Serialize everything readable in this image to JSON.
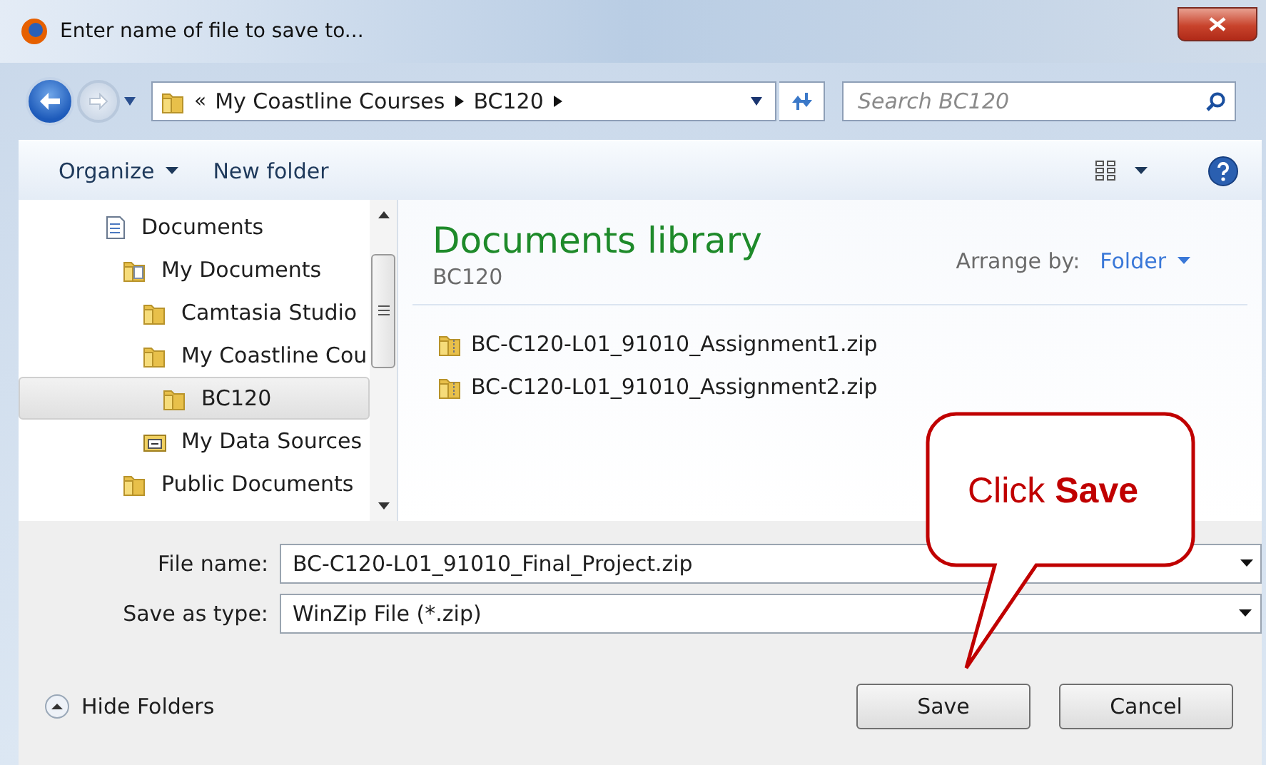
{
  "window": {
    "title": "Enter name of file to save to..."
  },
  "address": {
    "overflow": "«",
    "crumbs": [
      "My Coastline Courses",
      "BC120"
    ]
  },
  "search": {
    "placeholder": "Search BC120"
  },
  "toolbar": [
    "Organize",
    "New folder"
  ],
  "tree": [
    {
      "label": "Documents",
      "kind": "document",
      "selected": false,
      "children": [
        {
          "label": "My Documents",
          "kind": "library",
          "selected": false,
          "children": [
            {
              "label": "Camtasia Studio",
              "kind": "folder",
              "selected": false
            },
            {
              "label": "My Coastline Cou",
              "kind": "folder",
              "selected": false,
              "children": [
                {
                  "label": "BC120",
                  "kind": "folder",
                  "selected": true
                }
              ]
            },
            {
              "label": "My Data Sources",
              "kind": "datasource",
              "selected": false
            }
          ]
        },
        {
          "label": "Public Documents",
          "kind": "folder",
          "selected": false
        }
      ]
    }
  ],
  "library": {
    "title": "Documents library",
    "subtitle": "BC120",
    "arrange_label": "Arrange by:",
    "arrange_value": "Folder"
  },
  "files": [
    "BC-C120-L01_91010_Assignment1.zip",
    "BC-C120-L01_91010_Assignment2.zip"
  ],
  "form": {
    "file_name_label": "File name:",
    "file_name": "BC-C120-L01_91010_Final_Project.zip",
    "type_label": "Save as type:",
    "type": "WinZip File (*.zip)"
  },
  "hide_folders": "Hide Folders",
  "buttons": [
    "Save",
    "Cancel"
  ],
  "callout": "Click **Save**"
}
